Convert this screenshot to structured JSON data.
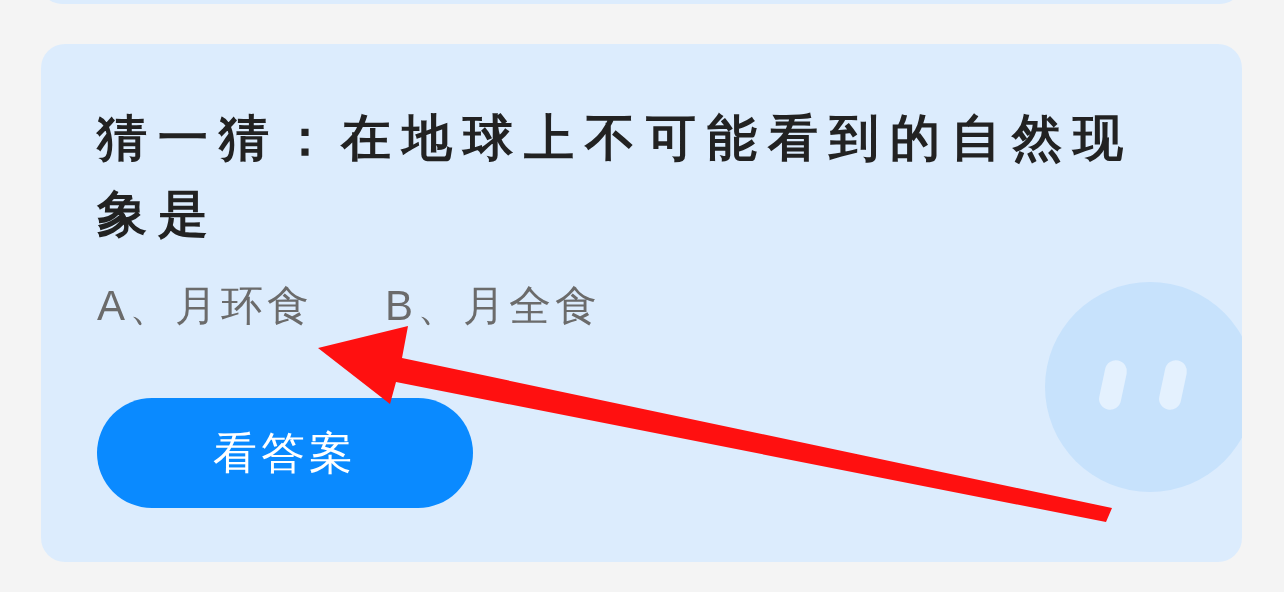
{
  "question": {
    "title": "猜一猜：在地球上不可能看到的自然现象是",
    "options": [
      "A、月环食",
      "B、月全食"
    ],
    "button": "看答案"
  }
}
